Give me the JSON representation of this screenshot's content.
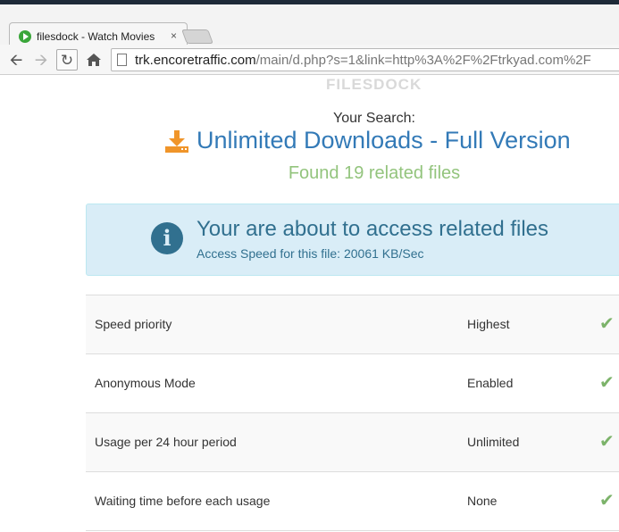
{
  "browser": {
    "tab_title": "filesdock - Watch Movies",
    "tab_close": "×",
    "url_host": "trk.encoretraffic.com",
    "url_path": "/main/d.php?s=1&link=http%3A%2F%2Ftrkyad.com%2F"
  },
  "page": {
    "logo_text": "FILESDOCK",
    "search_label": "Your Search:",
    "download_title": "Unlimited Downloads - Full Version",
    "found_text": "Found 19 related files",
    "info": {
      "title": "Your are about to access related files",
      "subtitle": "Access Speed for this file: 20061 KB/Sec"
    },
    "features": [
      {
        "name": "Speed priority",
        "value": "Highest"
      },
      {
        "name": "Anonymous Mode",
        "value": "Enabled"
      },
      {
        "name": "Usage per 24 hour period",
        "value": "Unlimited"
      },
      {
        "name": "Waiting time before each usage",
        "value": "None"
      }
    ]
  },
  "colors": {
    "link_blue": "#337ab7",
    "found_green": "#93c47d",
    "info_bg": "#d9edf7",
    "info_text": "#31708f",
    "download_orange": "#f0952a",
    "check_green": "#7cb36a"
  },
  "icons": {
    "favicon": "play-icon",
    "download": "download-icon",
    "info": "info-icon",
    "check": "checkmark-icon"
  }
}
